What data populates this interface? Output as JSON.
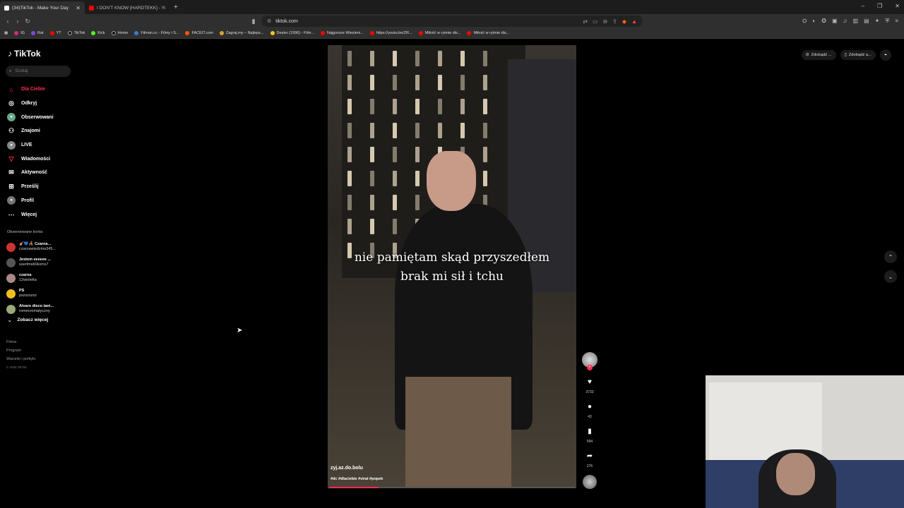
{
  "browser": {
    "tabs": [
      {
        "title": "(34)TikTok - Make Your Day",
        "active": true
      },
      {
        "title": "I DON'T KNOW [HARDTEKK] - YouTu...",
        "active": false
      }
    ],
    "url": "tiktok.com",
    "bookmarks": [
      "IG",
      "Rat",
      "YT",
      "TikTok",
      "Kick",
      "Home",
      "Filman.cc - Filmy i S...",
      "FACEIT.com",
      "Zagraj.my – Najleps...",
      "Dealer (1996) - Film...",
      "Najgorsze Wiezieni...",
      "https://youtu.be/ZR...",
      "Miłość w rytmie dis...",
      "Miłość w rytmie dis..."
    ]
  },
  "tiktok": {
    "logo": "TikTok",
    "search_placeholder": "Szukaj",
    "nav": [
      {
        "label": "Dla Ciebie",
        "icon": "home-icon",
        "active": true
      },
      {
        "label": "Odkryj",
        "icon": "compass-icon"
      },
      {
        "label": "Obserwowani",
        "icon": "following-icon"
      },
      {
        "label": "Znajomi",
        "icon": "friends-icon"
      },
      {
        "label": "LIVE",
        "icon": "live-icon"
      },
      {
        "label": "Wiadomości",
        "icon": "messages-icon"
      },
      {
        "label": "Aktywność",
        "icon": "activity-icon"
      },
      {
        "label": "Prześlij",
        "icon": "upload-icon"
      },
      {
        "label": "Profil",
        "icon": "profile-icon"
      },
      {
        "label": "Więcej",
        "icon": "more-icon"
      }
    ],
    "followed_title": "Obserwowane konta",
    "followed": [
      {
        "name": "🎸💙🦂 Czarna...",
        "handle": "czarnawiedzma345..."
      },
      {
        "name": "Jestem eeeeee ...",
        "handle": "usertmsb0kxms7"
      },
      {
        "name": "czarna",
        "handle": "12wioletta"
      },
      {
        "name": "PS",
        "handle": "pszszszsz"
      },
      {
        "name": "Alvaro disco tani...",
        "handle": "romeoromatyczny"
      }
    ],
    "see_more": "Zobacz więcej",
    "footer": [
      "Firma",
      "Program",
      "Warunki i polityki"
    ],
    "copyright": "© 2025 TikTok",
    "top_buttons": [
      "Zdobądź ...",
      "Zdobądź a..."
    ],
    "video": {
      "subtitle_line1": "nie pamiętam skąd przyszedłem",
      "subtitle_line2": "brak mi sił i tchu",
      "username": "zyj.az.do.bolu",
      "tags": "#dc #dlaciebie #viral #popek",
      "progress": 0.2
    },
    "actions": {
      "likes": "3733",
      "comments": "43",
      "saves": "594",
      "shares": "276"
    }
  },
  "colors": {
    "accent": "#fe2c55",
    "background": "#000000"
  }
}
